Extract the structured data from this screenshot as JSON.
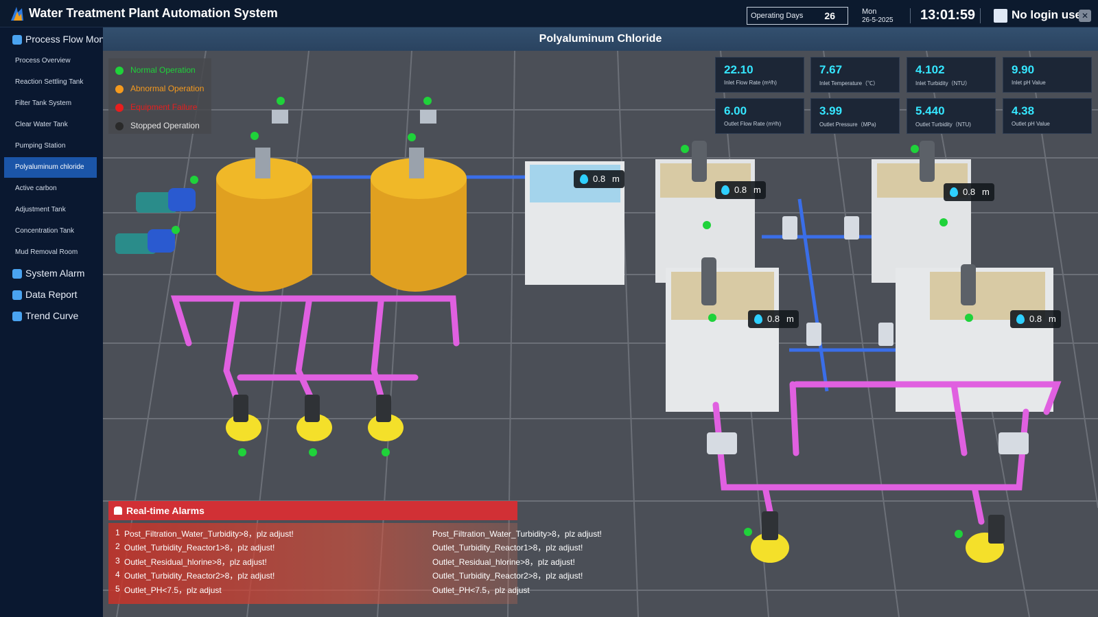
{
  "header": {
    "app_title": "Water Treatment Plant Automation System",
    "operating_days_label": "Operating Days",
    "operating_days_value": "26",
    "weekday": "Mon",
    "date": "26-5-2025",
    "time": "13:01:59",
    "user": "No login user",
    "logo_icon": "flame-logo-icon",
    "user_icon": "user-icon",
    "close_icon": "close-icon"
  },
  "sidebar": {
    "groups": [
      {
        "label": "Process Flow Mon",
        "icon": "process-icon"
      },
      {
        "label": "System Alarm",
        "icon": "alarm-shield-icon"
      },
      {
        "label": "Data Report",
        "icon": "report-icon"
      },
      {
        "label": "Trend Curve",
        "icon": "chart-icon"
      }
    ],
    "items": [
      {
        "label": "Process Overview"
      },
      {
        "label": "Reaction Settling Tank"
      },
      {
        "label": "Filter Tank System"
      },
      {
        "label": "Clear Water Tank"
      },
      {
        "label": "Pumping Station"
      },
      {
        "label": "Polyaluminum chloride"
      },
      {
        "label": "Active carbon"
      },
      {
        "label": "Adjustment Tank"
      },
      {
        "label": "Concentration Tank"
      },
      {
        "label": "Mud Removal Room"
      }
    ],
    "active_item": "Polyaluminum chloride",
    "active_color": "#1b55a8"
  },
  "page": {
    "title": "Polyaluminum Chloride"
  },
  "legend": [
    {
      "label": "Normal Operation",
      "color": "#1fd23a"
    },
    {
      "label": "Abnormal Operation",
      "color": "#f59a1e"
    },
    {
      "label": "Equipment Failure",
      "color": "#e81e1e"
    },
    {
      "label": "Stopped Operation",
      "color": "#2a2a2a"
    }
  ],
  "metrics": [
    {
      "value": "22.10",
      "label": "Inlet Flow Rate (m³/h)"
    },
    {
      "value": "7.67",
      "label": "Inlet Temperature（℃）"
    },
    {
      "value": "4.102",
      "label": "Inlet Turbidity（NTU）"
    },
    {
      "value": "9.90",
      "label": "Inlet pH Value"
    },
    {
      "value": "6.00",
      "label": "Outlet Flow Rate (m³/h)"
    },
    {
      "value": "3.99",
      "label": "Outlet Pressure（MPa)"
    },
    {
      "value": "5.440",
      "label": "Outlet Turbidity（NTU)"
    },
    {
      "value": "4.38",
      "label": "Outlet pH Value"
    }
  ],
  "levels": [
    {
      "value": "0.8",
      "unit": "m"
    },
    {
      "value": "0.8",
      "unit": "m"
    },
    {
      "value": "0.8",
      "unit": "m"
    },
    {
      "value": "0.8",
      "unit": "m"
    },
    {
      "value": "0.8",
      "unit": "m"
    }
  ],
  "alarms": {
    "title": "Real-time Alarms",
    "bell_icon": "alarm-bell-icon",
    "items": [
      {
        "num": "1",
        "text": "Post_Filtration_Water_Turbidity>8，plz adjust!"
      },
      {
        "num": "2",
        "text": "Outlet_Turbidity_Reactor1>8，plz adjust!"
      },
      {
        "num": "3",
        "text": "Outlet_Residual_hlorine>8，plz adjust!"
      },
      {
        "num": "4",
        "text": "Outlet_Turbidity_Reactor2>8，plz adjust!"
      },
      {
        "num": "5",
        "text": "Outlet_PH<7.5，plz adjust"
      }
    ]
  }
}
